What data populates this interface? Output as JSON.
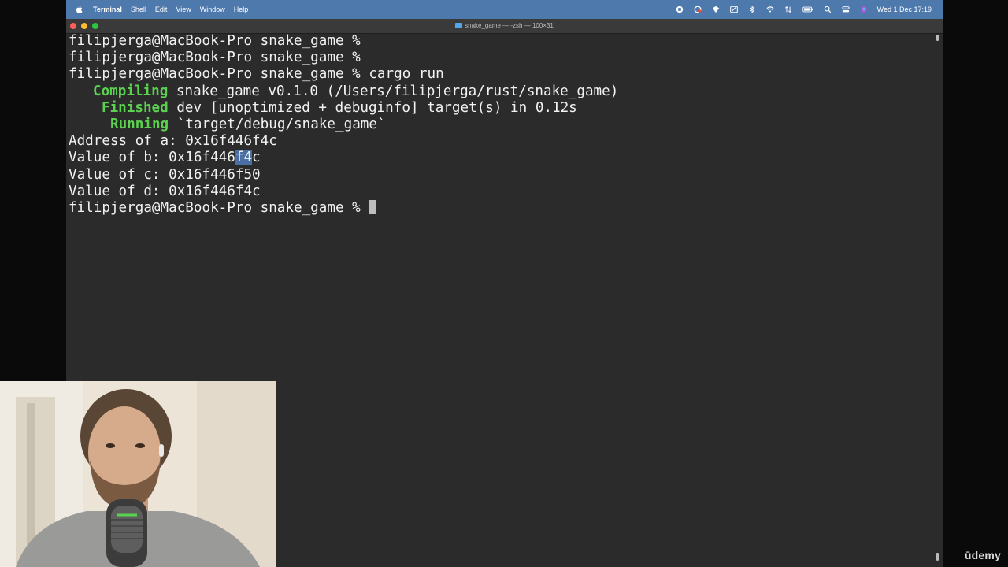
{
  "menubar": {
    "app_name": "Terminal",
    "items": [
      "Shell",
      "Edit",
      "View",
      "Window",
      "Help"
    ],
    "icons": [
      "stop-record-icon",
      "creative-cloud-icon",
      "vpn-icon",
      "pen-icon",
      "bluetooth-icon",
      "wifi-icon",
      "transfer-icon",
      "battery-icon",
      "search-icon",
      "control-center-icon",
      "siri-icon"
    ],
    "clock": "Wed 1 Dec  17:19"
  },
  "window": {
    "title": "snake_game — -zsh — 100×31"
  },
  "terminal": {
    "lines": {
      "l1": "filipjerga@MacBook-Pro snake_game % ",
      "l2": "filipjerga@MacBook-Pro snake_game % ",
      "l3": "filipjerga@MacBook-Pro snake_game % cargo run",
      "l4_label": "Compiling",
      "l4_text": " snake_game v0.1.0 (/Users/filipjerga/rust/snake_game)",
      "l5_label": "Finished",
      "l5_text": " dev [unoptimized + debuginfo] target(s) in 0.12s",
      "l6_label": "Running",
      "l6_text": " `target/debug/snake_game`",
      "l7": "Address of a: 0x16f446f4c",
      "l8_prefix": "Value of b: 0x16f446",
      "l8_highlight": "f4",
      "l8_suffix": "c",
      "l9": "Value of c: 0x16f446f50",
      "l10": "Value of d: 0x16f446f4c",
      "l11": "filipjerga@MacBook-Pro snake_game % "
    }
  },
  "watermark": "ūdemy",
  "colors": {
    "menubar_bg": "#4d79ad",
    "terminal_bg": "#2b2b2b",
    "cargo_green": "#5bd24f",
    "selection": "#4a6fa5"
  }
}
